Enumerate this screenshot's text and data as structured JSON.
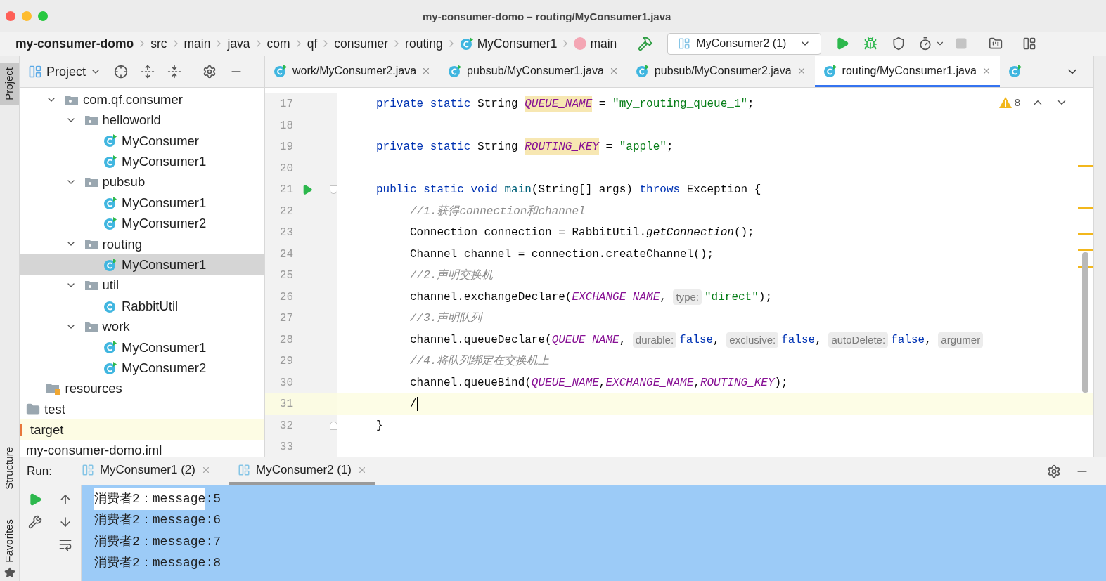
{
  "window": {
    "title": "my-consumer-domo – routing/MyConsumer1.java"
  },
  "breadcrumbs": [
    {
      "label": "my-consumer-domo",
      "kind": "project"
    },
    {
      "label": "src",
      "kind": "folder"
    },
    {
      "label": "main",
      "kind": "folder"
    },
    {
      "label": "java",
      "kind": "folder"
    },
    {
      "label": "com",
      "kind": "folder"
    },
    {
      "label": "qf",
      "kind": "folder"
    },
    {
      "label": "consumer",
      "kind": "folder"
    },
    {
      "label": "routing",
      "kind": "folder"
    },
    {
      "label": "MyConsumer1",
      "kind": "class"
    },
    {
      "label": "main",
      "kind": "method"
    }
  ],
  "run_config": {
    "label": "MyConsumer2 (1)"
  },
  "toolbar": {
    "stop_disabled": true
  },
  "left_strip": [
    {
      "label": "Project",
      "selected": true
    },
    {
      "label": "Structure",
      "selected": false
    },
    {
      "label": "Favorites",
      "selected": false
    }
  ],
  "project_panel": {
    "title": "Project"
  },
  "tree": [
    {
      "children": [
        {
          "children": [
            {
              "label": "com.qf.consumer",
              "kind": "package",
              "expanded": true,
              "selected": false,
              "children": [
                {
                  "label": "helloworld",
                  "kind": "package",
                  "expanded": true,
                  "selected": false,
                  "children": [
                    {
                      "label": "MyConsumer",
                      "kind": "runnable-class",
                      "selected": false
                    },
                    {
                      "label": "MyConsumer1",
                      "kind": "runnable-class",
                      "selected": false
                    }
                  ]
                },
                {
                  "label": "pubsub",
                  "kind": "package",
                  "expanded": true,
                  "selected": false,
                  "children": [
                    {
                      "label": "MyConsumer1",
                      "kind": "runnable-class",
                      "selected": false
                    },
                    {
                      "label": "MyConsumer2",
                      "kind": "runnable-class",
                      "selected": false
                    }
                  ]
                },
                {
                  "label": "routing",
                  "kind": "package",
                  "expanded": true,
                  "selected": false,
                  "children": [
                    {
                      "label": "MyConsumer1",
                      "kind": "runnable-class",
                      "selected": true
                    }
                  ]
                },
                {
                  "label": "util",
                  "kind": "package",
                  "expanded": true,
                  "selected": false,
                  "children": [
                    {
                      "label": "RabbitUtil",
                      "kind": "class",
                      "selected": false
                    }
                  ]
                },
                {
                  "label": "work",
                  "kind": "package",
                  "expanded": true,
                  "selected": false,
                  "children": [
                    {
                      "label": "MyConsumer1",
                      "kind": "runnable-class",
                      "selected": false
                    },
                    {
                      "label": "MyConsumer2",
                      "kind": "runnable-class",
                      "selected": false
                    }
                  ]
                }
              ]
            }
          ]
        },
        {
          "label": "resources",
          "kind": "resources-folder",
          "selected": false
        }
      ]
    },
    {
      "label": "test",
      "kind": "folder",
      "selected": false
    },
    {
      "label": "target",
      "kind": "excluded-folder",
      "selected": false
    },
    {
      "label": "my-consumer-domo.iml",
      "kind": "module-file",
      "selected": false
    }
  ],
  "editor_tabs": [
    {
      "label": "work/MyConsumer2.java",
      "selected": false
    },
    {
      "label": "pubsub/MyConsumer1.java",
      "selected": false
    },
    {
      "label": "pubsub/MyConsumer2.java",
      "selected": false
    },
    {
      "label": "routing/MyConsumer1.java",
      "selected": true
    },
    {
      "selected": false
    }
  ],
  "inspections": {
    "warnings": "8"
  },
  "code": [
    {
      "number": "17",
      "kind": "member",
      "runnable": false,
      "fold_start": false,
      "fold_end": false,
      "current": false,
      "tokens": [
        {
          "kind": "keyword",
          "text": "private static "
        },
        {
          "kind": "plain",
          "text": "String "
        },
        {
          "kind": "field-highlight",
          "text": "QUEUE_NAME"
        },
        {
          "kind": "plain",
          "text": " = "
        },
        {
          "kind": "string",
          "text": "\"my_routing_queue_1\""
        },
        {
          "kind": "plain",
          "text": ";"
        }
      ]
    },
    {
      "number": "18",
      "kind": "member",
      "runnable": false,
      "fold_start": false,
      "fold_end": false,
      "current": false
    },
    {
      "number": "19",
      "kind": "member",
      "runnable": false,
      "fold_start": false,
      "fold_end": false,
      "current": false,
      "tokens": [
        {
          "kind": "keyword",
          "text": "private static "
        },
        {
          "kind": "plain",
          "text": "String "
        },
        {
          "kind": "field-highlight",
          "text": "ROUTING_KEY"
        },
        {
          "kind": "plain",
          "text": " = "
        },
        {
          "kind": "string",
          "text": "\"apple\""
        },
        {
          "kind": "plain",
          "text": ";"
        }
      ]
    },
    {
      "number": "20",
      "kind": "member",
      "runnable": false,
      "fold_start": false,
      "fold_end": false,
      "current": false
    },
    {
      "number": "21",
      "kind": "member",
      "runnable": true,
      "fold_start": true,
      "fold_end": false,
      "current": false,
      "tokens": [
        {
          "kind": "keyword",
          "text": "public static void "
        },
        {
          "kind": "method-decl",
          "text": "main"
        },
        {
          "kind": "plain",
          "text": "(String[] args) "
        },
        {
          "kind": "keyword",
          "text": "throws "
        },
        {
          "kind": "plain",
          "text": "Exception {"
        }
      ]
    },
    {
      "number": "22",
      "kind": "body",
      "runnable": false,
      "fold_start": false,
      "fold_end": false,
      "current": false,
      "tokens": [
        {
          "kind": "comment",
          "text": "//1.获得connection和channel"
        }
      ]
    },
    {
      "number": "23",
      "kind": "body",
      "runnable": false,
      "fold_start": false,
      "fold_end": false,
      "current": false,
      "tokens": [
        {
          "kind": "plain",
          "text": "Connection connection = RabbitUtil."
        },
        {
          "kind": "static-call",
          "text": "getConnection"
        },
        {
          "kind": "plain",
          "text": "();"
        }
      ]
    },
    {
      "number": "24",
      "kind": "body",
      "runnable": false,
      "fold_start": false,
      "fold_end": false,
      "current": false,
      "tokens": [
        {
          "kind": "plain",
          "text": "Channel channel = connection.createChannel();"
        }
      ]
    },
    {
      "number": "25",
      "kind": "body",
      "runnable": false,
      "fold_start": false,
      "fold_end": false,
      "current": false,
      "tokens": [
        {
          "kind": "comment",
          "text": "//2.声明交换机"
        }
      ]
    },
    {
      "number": "26",
      "kind": "body",
      "runnable": false,
      "fold_start": false,
      "fold_end": false,
      "current": false,
      "tokens": [
        {
          "kind": "plain",
          "text": "channel.exchangeDeclare("
        },
        {
          "kind": "field",
          "text": "EXCHANGE_NAME"
        },
        {
          "kind": "plain",
          "text": ", "
        },
        {
          "kind": "hint",
          "text": "type:"
        },
        {
          "kind": "string",
          "text": "\"direct\""
        },
        {
          "kind": "plain",
          "text": ");"
        }
      ]
    },
    {
      "number": "27",
      "kind": "body",
      "runnable": false,
      "fold_start": false,
      "fold_end": false,
      "current": false,
      "tokens": [
        {
          "kind": "comment",
          "text": "//3.声明队列"
        }
      ]
    },
    {
      "number": "28",
      "kind": "body",
      "runnable": false,
      "fold_start": false,
      "fold_end": false,
      "current": false,
      "tokens": [
        {
          "kind": "plain",
          "text": "channel.queueDeclare("
        },
        {
          "kind": "field",
          "text": "QUEUE_NAME"
        },
        {
          "kind": "plain",
          "text": ", "
        },
        {
          "kind": "hint",
          "text": "durable:"
        },
        {
          "kind": "keyword",
          "text": "false"
        },
        {
          "kind": "plain",
          "text": ", "
        },
        {
          "kind": "hint",
          "text": "exclusive:"
        },
        {
          "kind": "keyword",
          "text": "false"
        },
        {
          "kind": "plain",
          "text": ", "
        },
        {
          "kind": "hint",
          "text": "autoDelete:"
        },
        {
          "kind": "keyword",
          "text": "false"
        },
        {
          "kind": "plain",
          "text": ", "
        },
        {
          "kind": "hint",
          "text": "argumer"
        }
      ]
    },
    {
      "number": "29",
      "kind": "body",
      "runnable": false,
      "fold_start": false,
      "fold_end": false,
      "current": false,
      "tokens": [
        {
          "kind": "comment",
          "text": "//4.将队列绑定在交换机上"
        }
      ]
    },
    {
      "number": "30",
      "kind": "body",
      "runnable": false,
      "fold_start": false,
      "fold_end": false,
      "current": false,
      "tokens": [
        {
          "kind": "plain",
          "text": "channel.queueBind("
        },
        {
          "kind": "field",
          "text": "QUEUE_NAME"
        },
        {
          "kind": "plain",
          "text": ","
        },
        {
          "kind": "field",
          "text": "EXCHANGE_NAME"
        },
        {
          "kind": "plain",
          "text": ","
        },
        {
          "kind": "field",
          "text": "ROUTING_KEY"
        },
        {
          "kind": "plain",
          "text": ");"
        }
      ]
    },
    {
      "number": "31",
      "kind": "body",
      "runnable": false,
      "fold_start": false,
      "fold_end": false,
      "current": true,
      "tokens": [
        {
          "kind": "plain",
          "text": "/"
        }
      ]
    },
    {
      "number": "32",
      "kind": "member",
      "runnable": false,
      "fold_start": false,
      "fold_end": true,
      "current": false,
      "tokens": [
        {
          "kind": "plain",
          "text": "}"
        }
      ]
    },
    {
      "number": "33",
      "kind": "member",
      "runnable": false,
      "fold_start": false,
      "fold_end": false,
      "current": false
    }
  ],
  "run_panel": {
    "label": "Run:",
    "tabs": [
      {
        "label": "MyConsumer1 (2)",
        "selected": false
      },
      {
        "label": "MyConsumer2 (1)",
        "selected": true
      }
    ],
    "console": [
      [
        {
          "text": "消费者2：message",
          "selected": false
        },
        {
          "text": ":5",
          "selected": true
        }
      ],
      [
        {
          "text": "消费者2：message:6",
          "selected": true
        }
      ],
      [
        {
          "text": "消费者2：message:7",
          "selected": true
        }
      ],
      [
        {
          "text": "消费者2：message:8",
          "selected": true
        }
      ]
    ]
  }
}
